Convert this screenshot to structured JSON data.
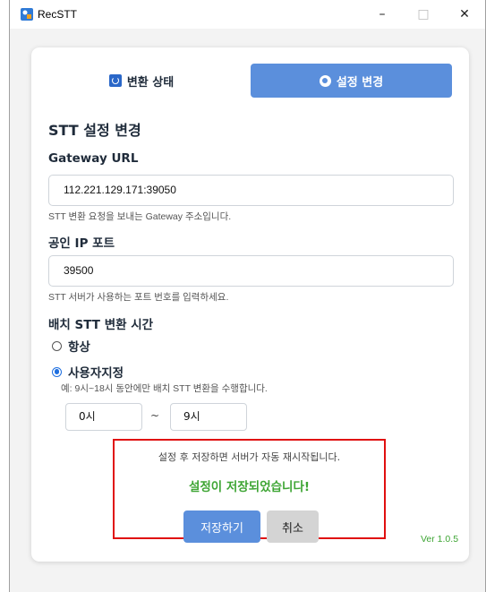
{
  "window": {
    "title": "RecSTT",
    "minimize": "–",
    "maximize": "□",
    "close": "✕"
  },
  "tabs": {
    "status_label": "변환 상태",
    "settings_label": "설정 변경"
  },
  "form": {
    "title": "STT 설정 변경",
    "gateway": {
      "label": "Gateway URL",
      "value": "112.221.129.171:39050",
      "help": "STT 변환 요청을 보내는 Gateway 주소입니다."
    },
    "port": {
      "label": "공인 IP 포트",
      "value": "39500",
      "help": "STT 서버가 사용하는 포트 번호를 입력하세요."
    },
    "batch": {
      "label": "배치 STT 변환 시간",
      "option_always": "항상",
      "option_custom": "사용자지정",
      "selected": "사용자지정",
      "custom_help": "예: 9시~18시 동안에만 배치 STT 변환을 수행합니다.",
      "start_hour": "0시",
      "separator": "~",
      "end_hour": "9시"
    }
  },
  "save_area": {
    "notice": "설정 후 저장하면 서버가 자동 재시작됩니다.",
    "success_message": "설정이 저장되었습니다!",
    "save_button": "저장하기",
    "cancel_button": "취소"
  },
  "version": "Ver 1.0.5",
  "colors": {
    "accent": "#5b8fdc",
    "success": "#3ea534",
    "highlight_border": "#e01010"
  },
  "icons": {
    "app": "app-logo-icon",
    "status_tab": "sync-icon",
    "settings_tab": "gear-icon"
  }
}
